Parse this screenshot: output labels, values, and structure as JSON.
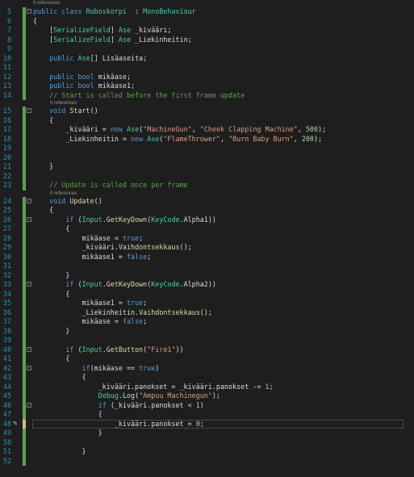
{
  "editor": {
    "top_hint": "0 references",
    "lines": [
      {
        "n": "5",
        "fold": "−",
        "gut": "g",
        "seg": [
          [
            "kw",
            "public class "
          ],
          [
            "ty",
            "Roboskorpi"
          ],
          [
            "",
            "  : "
          ],
          [
            "ty",
            "MonoBehaviour"
          ]
        ]
      },
      {
        "n": "6",
        "gut": "g",
        "seg": [
          [
            "",
            "{"
          ]
        ]
      },
      {
        "n": "7",
        "gut": "g",
        "seg": [
          [
            "",
            "    ["
          ],
          [
            "ty",
            "SerializeField"
          ],
          [
            "",
            "] "
          ],
          [
            "ty",
            "Ase"
          ],
          [
            "",
            " _kivääri;"
          ]
        ]
      },
      {
        "n": "8",
        "gut": "g",
        "seg": [
          [
            "",
            "    ["
          ],
          [
            "ty",
            "SerializeField"
          ],
          [
            "",
            "] "
          ],
          [
            "ty",
            "Ase"
          ],
          [
            "",
            " _Liekinheitin;"
          ]
        ]
      },
      {
        "n": "9",
        "gut": "g",
        "seg": []
      },
      {
        "n": "10",
        "gut": "g",
        "seg": [
          [
            "kw",
            "    public "
          ],
          [
            "ty",
            "Ase"
          ],
          [
            "",
            "[] Lisäaseita;"
          ]
        ]
      },
      {
        "n": "11",
        "gut": "g",
        "seg": []
      },
      {
        "n": "12",
        "gut": "g",
        "seg": [
          [
            "kw",
            "    public bool"
          ],
          [
            "",
            " mikäase;"
          ]
        ]
      },
      {
        "n": "13",
        "gut": "g",
        "seg": [
          [
            "kw",
            "    public bool"
          ],
          [
            "",
            " mikäase1;"
          ]
        ]
      },
      {
        "n": "14",
        "gut": "g",
        "seg": [
          [
            "cm",
            "    // Start is called before the first frame update"
          ]
        ]
      },
      {
        "hint": "0 references"
      },
      {
        "n": "15",
        "fold": "−",
        "gut": "g",
        "seg": [
          [
            "kw",
            "    void "
          ],
          [
            "fn",
            "Start"
          ],
          [
            "",
            "()"
          ]
        ]
      },
      {
        "n": "16",
        "gut": "g",
        "seg": [
          [
            "",
            "    {"
          ]
        ]
      },
      {
        "n": "17",
        "gut": "g",
        "seg": [
          [
            "",
            "        _kivääri = "
          ],
          [
            "kw",
            "new "
          ],
          [
            "ty",
            "Ase"
          ],
          [
            "",
            "("
          ],
          [
            "st",
            "\"MachineGun\""
          ],
          [
            "",
            ", "
          ],
          [
            "st",
            "\"Cheek Clapping Machine\""
          ],
          [
            "",
            ", "
          ],
          [
            "nm",
            "500"
          ],
          [
            "",
            ");"
          ]
        ]
      },
      {
        "n": "18",
        "gut": "g",
        "seg": [
          [
            "",
            "        _Liekinheitin = "
          ],
          [
            "kw",
            "new "
          ],
          [
            "ty",
            "Ase"
          ],
          [
            "",
            "("
          ],
          [
            "st",
            "\"FlameThrower\""
          ],
          [
            "",
            ", "
          ],
          [
            "st",
            "\"Burn Baby Burn\""
          ],
          [
            "",
            ", "
          ],
          [
            "nm",
            "200"
          ],
          [
            "",
            ");"
          ]
        ]
      },
      {
        "n": "19",
        "gut": "g",
        "seg": []
      },
      {
        "n": "20",
        "gut": "g",
        "seg": []
      },
      {
        "n": "21",
        "gut": "g",
        "seg": [
          [
            "",
            "    }"
          ]
        ]
      },
      {
        "n": "22",
        "gut": "g",
        "seg": []
      },
      {
        "n": "23",
        "gut": "g",
        "seg": [
          [
            "cm",
            "    // Update is called once per frame"
          ]
        ]
      },
      {
        "hint": "0 references"
      },
      {
        "n": "24",
        "fold": "−",
        "gut": "g",
        "seg": [
          [
            "kw",
            "    void "
          ],
          [
            "fn",
            "Update"
          ],
          [
            "",
            "()"
          ]
        ]
      },
      {
        "n": "25",
        "gut": "g",
        "seg": [
          [
            "",
            "    {"
          ]
        ]
      },
      {
        "n": "26",
        "fold": "−",
        "gut": "g",
        "seg": [
          [
            "kw",
            "        if "
          ],
          [
            "",
            "("
          ],
          [
            "ty",
            "Input"
          ],
          [
            ".",
            ""
          ],
          [
            "",
            "."
          ],
          [
            "fn",
            "GetKeyDown"
          ],
          [
            "",
            "("
          ],
          [
            "ty",
            "KeyCode"
          ],
          [
            "",
            "."
          ],
          [
            "fd",
            "Alpha1"
          ],
          [
            "",
            "))"
          ]
        ]
      },
      {
        "n": "27",
        "gut": "g",
        "seg": [
          [
            "",
            "        {"
          ]
        ]
      },
      {
        "n": "28",
        "gut": "g",
        "seg": [
          [
            "",
            "            mikäase = "
          ],
          [
            "kw",
            "true"
          ],
          [
            "",
            ";"
          ]
        ]
      },
      {
        "n": "29",
        "gut": "g",
        "seg": [
          [
            "",
            "            _kivääri."
          ],
          [
            "fn",
            "Vaihdontsekkaus"
          ],
          [
            "",
            "();"
          ]
        ]
      },
      {
        "n": "30",
        "gut": "g",
        "seg": [
          [
            "",
            "            mikäase1 = "
          ],
          [
            "kw",
            "false"
          ],
          [
            "",
            ";"
          ]
        ]
      },
      {
        "n": "31",
        "gut": "g",
        "seg": []
      },
      {
        "n": "32",
        "gut": "g",
        "seg": [
          [
            "",
            "        }"
          ]
        ]
      },
      {
        "n": "33",
        "fold": "−",
        "gut": "g",
        "seg": [
          [
            "kw",
            "        if "
          ],
          [
            "",
            "("
          ],
          [
            "ty",
            "Input"
          ],
          [
            "",
            "."
          ],
          [
            "fn",
            "GetKeyDown"
          ],
          [
            "",
            "("
          ],
          [
            "ty",
            "KeyCode"
          ],
          [
            "",
            "."
          ],
          [
            "fd",
            "Alpha2"
          ],
          [
            "",
            "))"
          ]
        ]
      },
      {
        "n": "34",
        "gut": "g",
        "seg": [
          [
            "",
            "        {"
          ]
        ]
      },
      {
        "n": "35",
        "gut": "g",
        "seg": [
          [
            "",
            "            mikäase1 = "
          ],
          [
            "kw",
            "true"
          ],
          [
            "",
            ";"
          ]
        ]
      },
      {
        "n": "36",
        "gut": "g",
        "seg": [
          [
            "",
            "            _Liekinheitin."
          ],
          [
            "fn",
            "Vaihdontsekkaus"
          ],
          [
            "",
            "();"
          ]
        ]
      },
      {
        "n": "37",
        "gut": "g",
        "seg": [
          [
            "",
            "            mikäase = "
          ],
          [
            "kw",
            "false"
          ],
          [
            "",
            ";"
          ]
        ]
      },
      {
        "n": "38",
        "gut": "g",
        "seg": [
          [
            "",
            "        }"
          ]
        ]
      },
      {
        "n": "39",
        "gut": "g",
        "seg": []
      },
      {
        "n": "40",
        "fold": "−",
        "gut": "g",
        "seg": [
          [
            "kw",
            "        if "
          ],
          [
            "",
            "("
          ],
          [
            "ty",
            "Input"
          ],
          [
            "",
            "."
          ],
          [
            "fn",
            "GetButton"
          ],
          [
            "",
            "("
          ],
          [
            "st",
            "\"Fire1\""
          ],
          [
            "",
            "))"
          ]
        ]
      },
      {
        "n": "41",
        "gut": "g",
        "seg": [
          [
            "",
            "        {"
          ]
        ]
      },
      {
        "n": "42",
        "fold": "−",
        "gut": "g",
        "seg": [
          [
            "kw",
            "            if"
          ],
          [
            "",
            "(mikäase == "
          ],
          [
            "kw",
            "true"
          ],
          [
            "",
            ")"
          ]
        ]
      },
      {
        "n": "43",
        "gut": "g",
        "seg": [
          [
            "",
            "            {"
          ]
        ]
      },
      {
        "n": "44",
        "gut": "g",
        "seg": [
          [
            "",
            "                _kivääri.panokset = _kivääri.panokset -= "
          ],
          [
            "nm",
            "1"
          ],
          [
            "",
            ";"
          ]
        ]
      },
      {
        "n": "45",
        "gut": "g",
        "seg": [
          [
            "ty",
            "                Debug"
          ],
          [
            "",
            "."
          ],
          [
            "fn",
            "Log"
          ],
          [
            "",
            "("
          ],
          [
            "st",
            "\"Ampuu Machinegun\""
          ],
          [
            "",
            ");"
          ]
        ]
      },
      {
        "n": "46",
        "fold": "−",
        "gut": "g",
        "seg": [
          [
            "kw",
            "                if "
          ],
          [
            "",
            "(_kivääri.panokset < "
          ],
          [
            "nm",
            "1"
          ],
          [
            "",
            ")"
          ]
        ]
      },
      {
        "n": "47",
        "gut": "g",
        "seg": [
          [
            "",
            "                {"
          ]
        ]
      },
      {
        "n": "48",
        "gut": "y",
        "cur": true,
        "seg": [
          [
            "",
            "                    _kivääri.panokset = "
          ],
          [
            "nm",
            "0"
          ],
          [
            "",
            ";"
          ]
        ]
      },
      {
        "n": "49",
        "gut": "g",
        "seg": [
          [
            "",
            "                }"
          ]
        ]
      },
      {
        "n": "50",
        "gut": "g",
        "seg": []
      },
      {
        "n": "51",
        "gut": "g",
        "seg": [
          [
            "",
            "            }"
          ]
        ]
      },
      {
        "n": "52",
        "gut": "g",
        "seg": []
      }
    ]
  }
}
